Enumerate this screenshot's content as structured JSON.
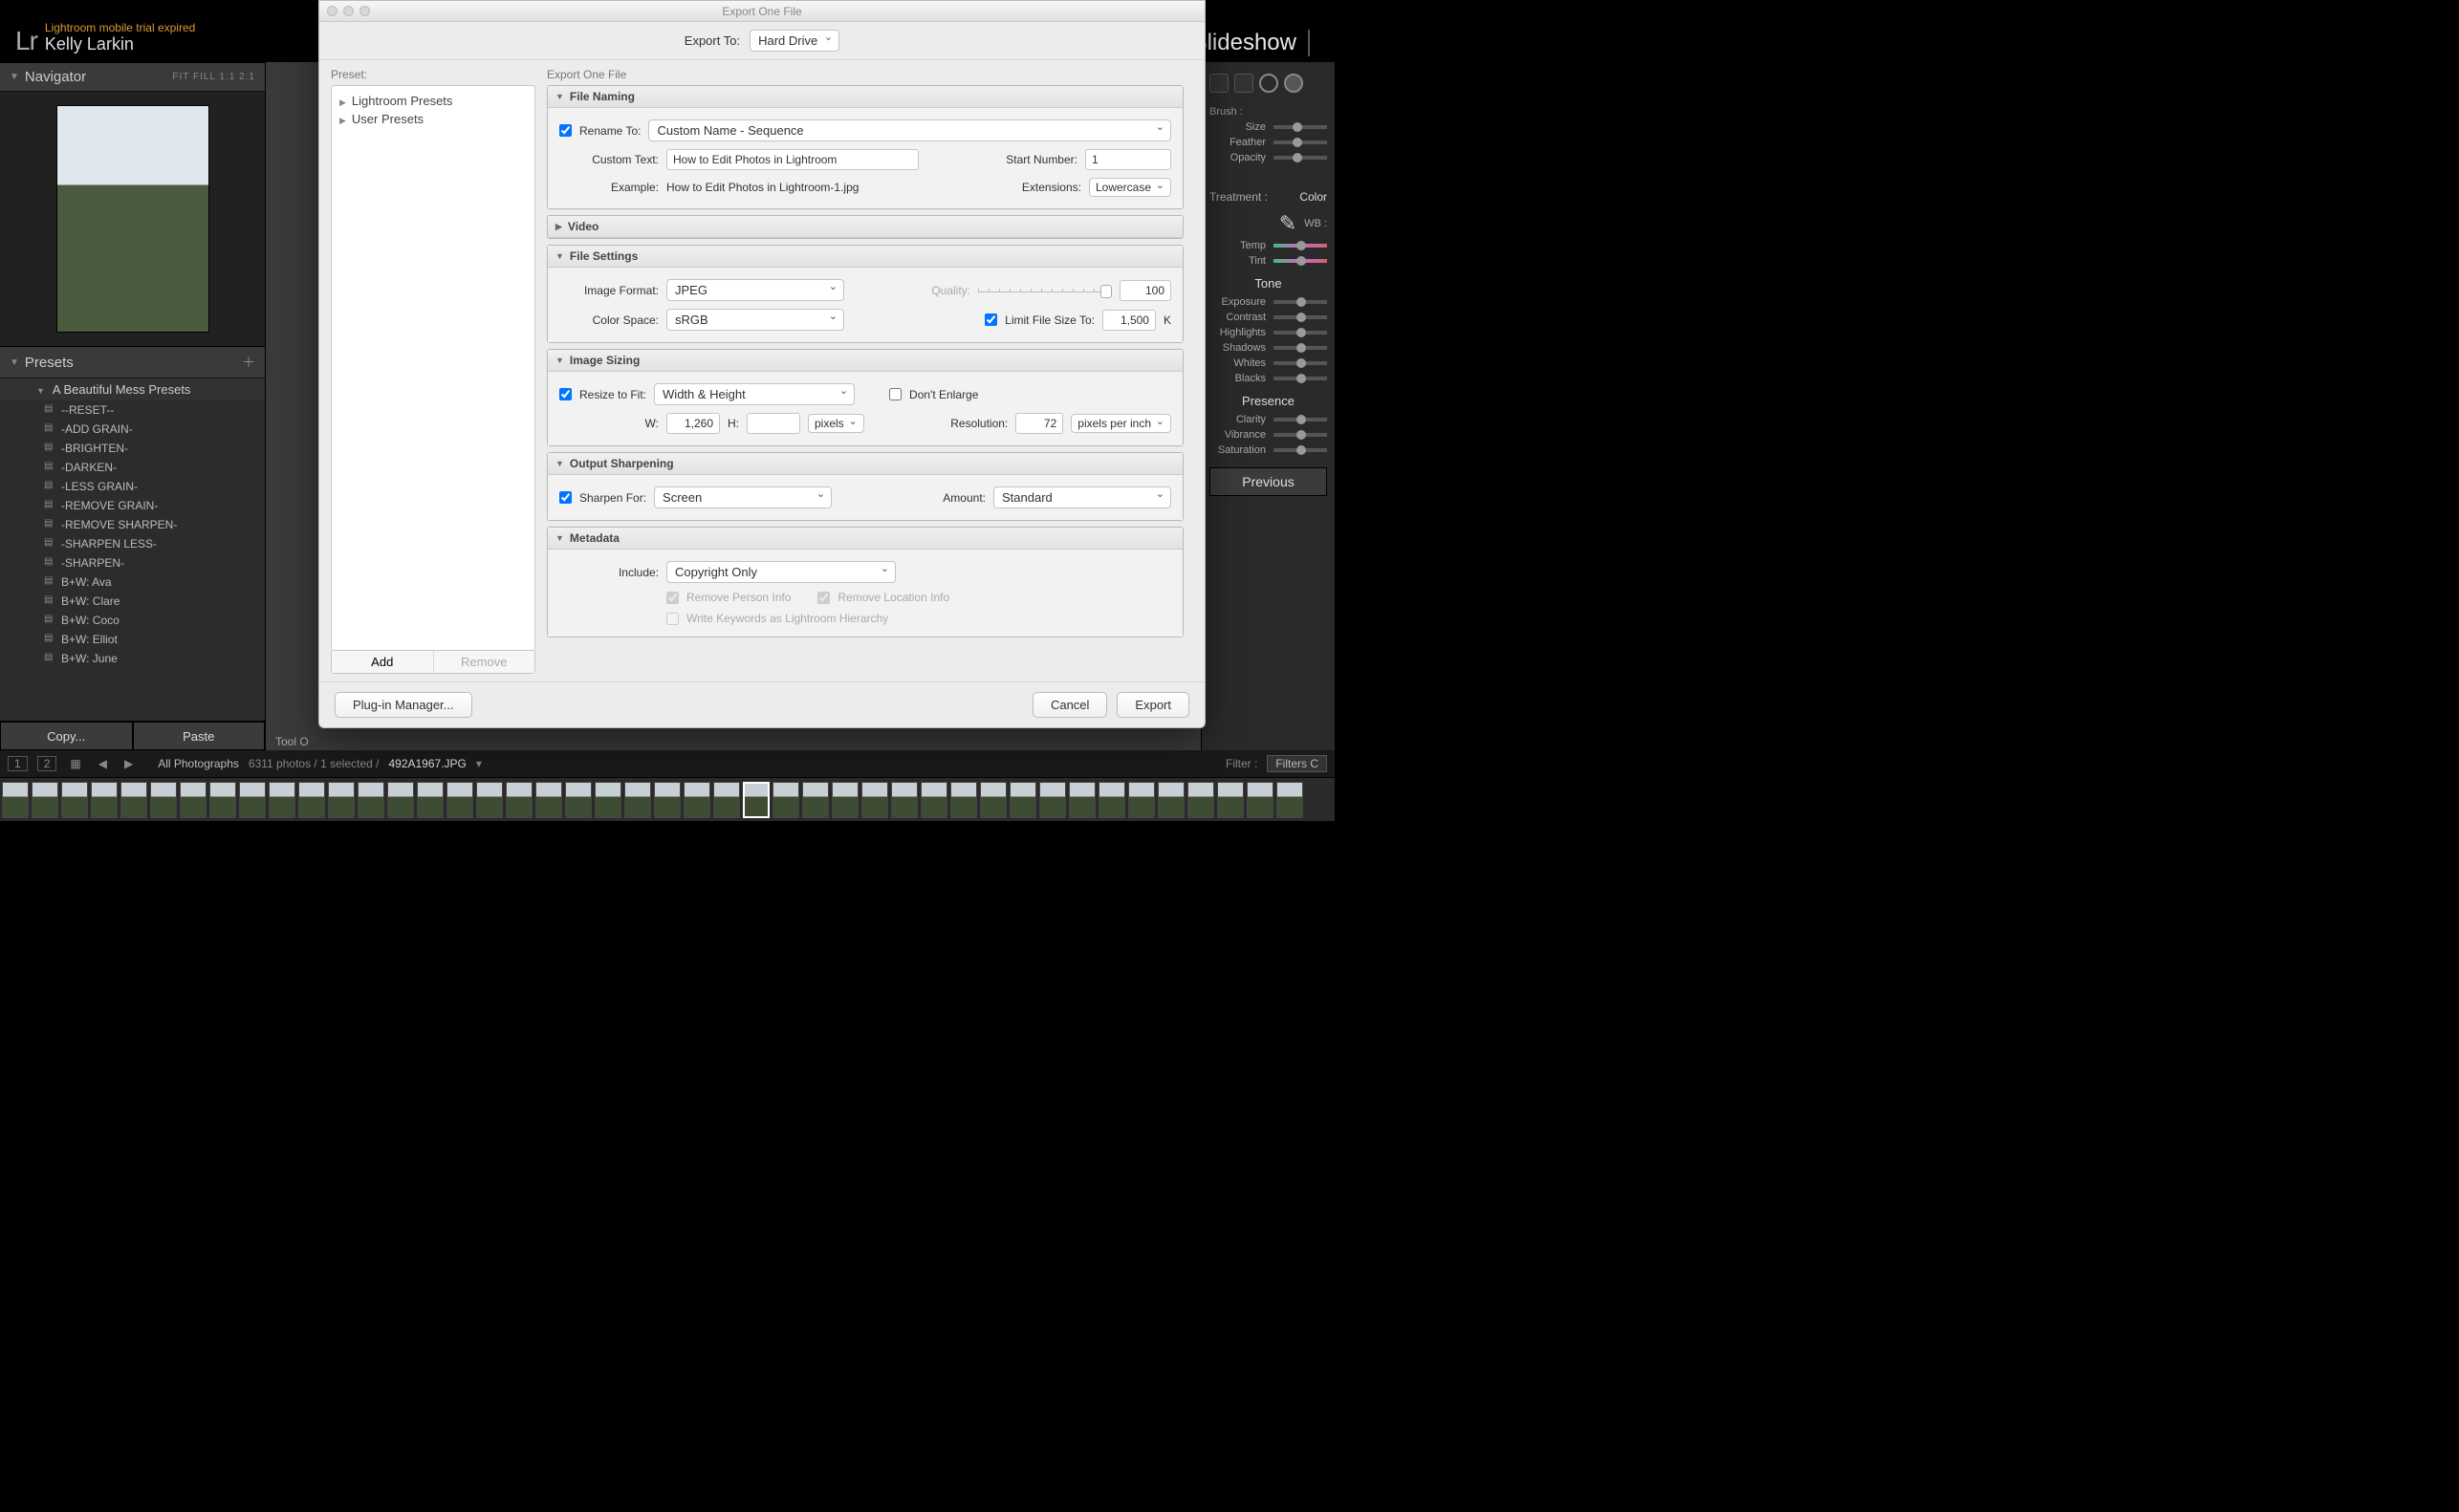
{
  "header": {
    "logo": "Lr",
    "trial_text": "Lightroom mobile trial expired",
    "user_name": "Kelly Larkin",
    "module": "Slideshow"
  },
  "navigator": {
    "title": "Navigator",
    "zoom_label": "FIT   FILL   1:1   2:1"
  },
  "presets": {
    "title": "Presets",
    "folder": "A Beautiful Mess Presets",
    "items": [
      "--RESET--",
      "-ADD GRAIN-",
      "-BRIGHTEN-",
      "-DARKEN-",
      "-LESS GRAIN-",
      "-REMOVE GRAIN-",
      "-REMOVE SHARPEN-",
      "-SHARPEN LESS-",
      "-SHARPEN-",
      "B+W: Ava",
      "B+W: Clare",
      "B+W: Coco",
      "B+W: Elliot",
      "B+W: June"
    ],
    "copy": "Copy...",
    "paste": "Paste"
  },
  "right_panel": {
    "brush_label": "Brush :",
    "size_label": "Size",
    "feather_label": "Feather",
    "opacity_label": "Opacity",
    "treatment_label": "Treatment :",
    "treatment_value": "Color",
    "wb_label": "WB :",
    "temp_label": "Temp",
    "tint_label": "Tint",
    "tone_label": "Tone",
    "exposure_label": "Exposure",
    "contrast_label": "Contrast",
    "highlights_label": "Highlights",
    "shadows_label": "Shadows",
    "whites_label": "Whites",
    "blacks_label": "Blacks",
    "presence_label": "Presence",
    "clarity_label": "Clarity",
    "vibrance_label": "Vibrance",
    "saturation_label": "Saturation",
    "previous_btn": "Previous"
  },
  "filmstrip": {
    "screen_1": "1",
    "screen_2": "2",
    "collection_label": "All Photographs",
    "count_text": "6311 photos / 1 selected /",
    "filename": "492A1967.JPG",
    "filter_label": "Filter :",
    "filters_btn": "Filters C",
    "tool_overlay_label": "Tool O"
  },
  "dialog": {
    "title": "Export One File",
    "export_to_label": "Export To:",
    "export_to_value": "Hard Drive",
    "preset_label": "Preset:",
    "preset_rows": [
      "Lightroom Presets",
      "User Presets"
    ],
    "add_label": "Add",
    "remove_label": "Remove",
    "right_label": "Export One File",
    "file_naming": {
      "header": "File Naming",
      "rename_to_label": "Rename To:",
      "rename_to_value": "Custom Name - Sequence",
      "custom_text_label": "Custom Text:",
      "custom_text_value": "How to Edit Photos in Lightroom",
      "start_number_label": "Start Number:",
      "start_number_value": "1",
      "example_label": "Example:",
      "example_value": "How to Edit Photos in Lightroom-1.jpg",
      "extensions_label": "Extensions:",
      "extensions_value": "Lowercase"
    },
    "video": {
      "header": "Video"
    },
    "file_settings": {
      "header": "File Settings",
      "image_format_label": "Image Format:",
      "image_format_value": "JPEG",
      "quality_label": "Quality:",
      "quality_value": "100",
      "color_space_label": "Color Space:",
      "color_space_value": "sRGB",
      "limit_label": "Limit File Size To:",
      "limit_value": "1,500",
      "limit_unit": "K"
    },
    "image_sizing": {
      "header": "Image Sizing",
      "resize_label": "Resize to Fit:",
      "resize_value": "Width & Height",
      "dont_enlarge_label": "Don't Enlarge",
      "w_label": "W:",
      "w_value": "1,260",
      "h_label": "H:",
      "h_value": "",
      "pixels_value": "pixels",
      "resolution_label": "Resolution:",
      "resolution_value": "72",
      "resolution_unit_value": "pixels per inch"
    },
    "sharpening": {
      "header": "Output Sharpening",
      "sharpen_for_label": "Sharpen For:",
      "sharpen_for_value": "Screen",
      "amount_label": "Amount:",
      "amount_value": "Standard"
    },
    "metadata": {
      "header": "Metadata",
      "include_label": "Include:",
      "include_value": "Copyright Only",
      "remove_person_label": "Remove Person Info",
      "remove_location_label": "Remove Location Info",
      "keywords_label": "Write Keywords as Lightroom Hierarchy"
    },
    "plugin_btn": "Plug-in Manager...",
    "cancel_btn": "Cancel",
    "export_btn": "Export"
  }
}
